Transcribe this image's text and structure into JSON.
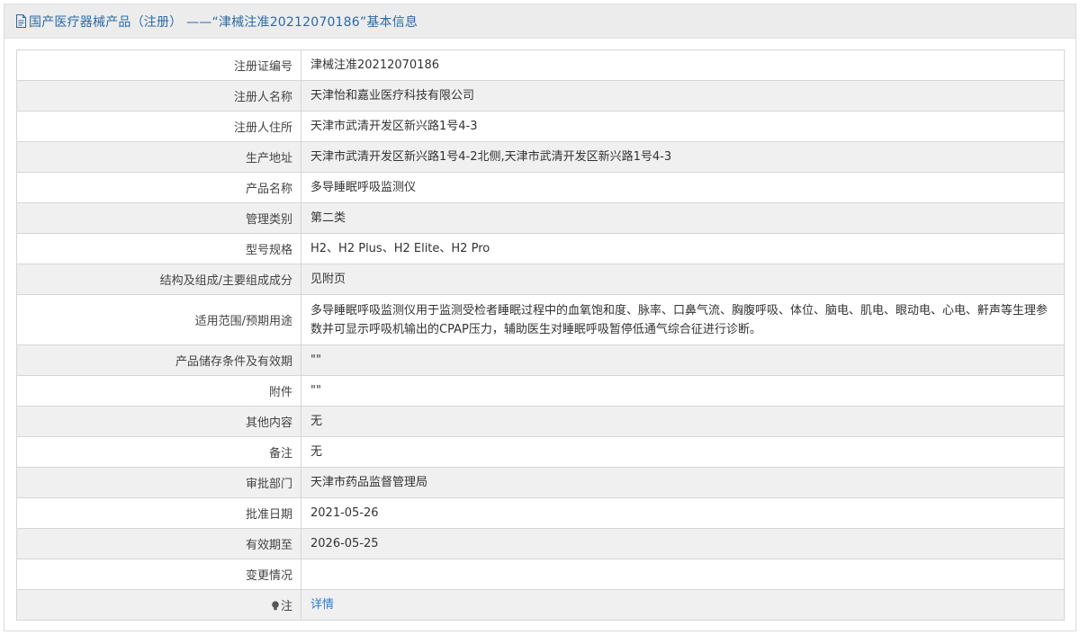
{
  "header": {
    "title": "国产医疗器械产品（注册） ——“津械注准20212070186”基本信息",
    "icon": "document-icon",
    "title_color": "#2b6aa8"
  },
  "rows": [
    {
      "label": "注册证编号",
      "value": "津械注准20212070186"
    },
    {
      "label": "注册人名称",
      "value": "天津怡和嘉业医疗科技有限公司"
    },
    {
      "label": "注册人住所",
      "value": "天津市武清开发区新兴路1号4-3"
    },
    {
      "label": "生产地址",
      "value": "天津市武清开发区新兴路1号4-2北侧,天津市武清开发区新兴路1号4-3"
    },
    {
      "label": "产品名称",
      "value": "多导睡眠呼吸监测仪"
    },
    {
      "label": "管理类别",
      "value": "第二类"
    },
    {
      "label": "型号规格",
      "value": "H2、H2 Plus、H2 Elite、H2 Pro"
    },
    {
      "label": "结构及组成/主要组成成分",
      "value": "见附页"
    },
    {
      "label": "适用范围/预期用途",
      "value": "多导睡眠呼吸监测仪用于监测受检者睡眠过程中的血氧饱和度、脉率、口鼻气流、胸腹呼吸、体位、脑电、肌电、眼动电、心电、鼾声等生理参数并可显示呼吸机输出的CPAP压力，辅助医生对睡眠呼吸暂停低通气综合征进行诊断。"
    },
    {
      "label": "产品储存条件及有效期",
      "value": "\"\""
    },
    {
      "label": "附件",
      "value": "\"\""
    },
    {
      "label": "其他内容",
      "value": "无"
    },
    {
      "label": "备注",
      "value": "无"
    },
    {
      "label": "审批部门",
      "value": "天津市药品监督管理局"
    },
    {
      "label": "批准日期",
      "value": "2021-05-26"
    },
    {
      "label": "有效期至",
      "value": "2026-05-25"
    },
    {
      "label": "变更情况",
      "value": ""
    }
  ],
  "note_row": {
    "label": "注",
    "icon": "bulb-icon",
    "link_text": "详情",
    "link_color": "#2b7bd2"
  }
}
